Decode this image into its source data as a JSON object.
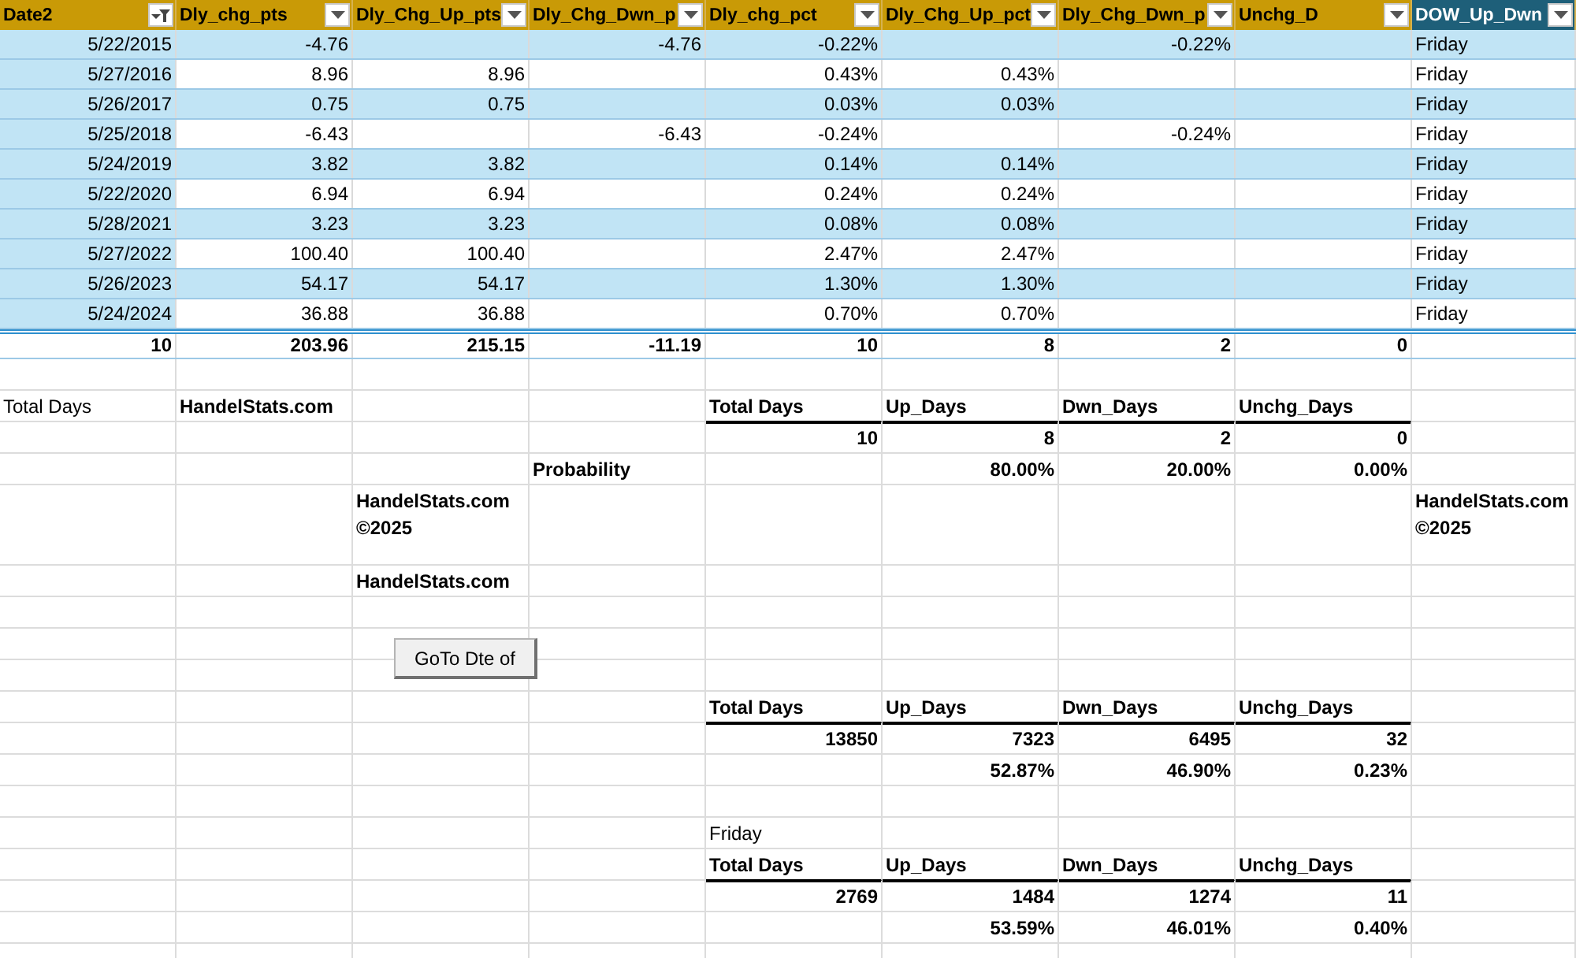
{
  "table": {
    "columns": [
      {
        "label": "Date2",
        "kind": "sorted",
        "selected": false
      },
      {
        "label": "Dly_chg_pts",
        "kind": "dropdown",
        "selected": false
      },
      {
        "label": "Dly_Chg_Up_pts",
        "kind": "dropdown",
        "selected": false
      },
      {
        "label": "Dly_Chg_Dwn_p",
        "kind": "dropdown",
        "selected": false
      },
      {
        "label": "Dly_chg_pct",
        "kind": "dropdown",
        "selected": false
      },
      {
        "label": "Dly_Chg_Up_pct",
        "kind": "dropdown",
        "selected": false
      },
      {
        "label": "Dly_Chg_Dwn_p",
        "kind": "dropdown",
        "selected": false
      },
      {
        "label": "Unchg_D",
        "kind": "dropdown",
        "selected": false
      },
      {
        "label": "DOW_Up_Dwn",
        "kind": "dropdown",
        "selected": true
      }
    ],
    "rows": [
      [
        "5/22/2015",
        "-4.76",
        null,
        "-4.76",
        "-0.22%",
        null,
        "-0.22%",
        null,
        "Friday"
      ],
      [
        "5/27/2016",
        "8.96",
        "8.96",
        null,
        "0.43%",
        "0.43%",
        null,
        null,
        "Friday"
      ],
      [
        "5/26/2017",
        "0.75",
        "0.75",
        null,
        "0.03%",
        "0.03%",
        null,
        null,
        "Friday"
      ],
      [
        "5/25/2018",
        "-6.43",
        null,
        "-6.43",
        "-0.24%",
        null,
        "-0.24%",
        null,
        "Friday"
      ],
      [
        "5/24/2019",
        "3.82",
        "3.82",
        null,
        "0.14%",
        "0.14%",
        null,
        null,
        "Friday"
      ],
      [
        "5/22/2020",
        "6.94",
        "6.94",
        null,
        "0.24%",
        "0.24%",
        null,
        null,
        "Friday"
      ],
      [
        "5/28/2021",
        "3.23",
        "3.23",
        null,
        "0.08%",
        "0.08%",
        null,
        null,
        "Friday"
      ],
      [
        "5/27/2022",
        "100.40",
        "100.40",
        null,
        "2.47%",
        "2.47%",
        null,
        null,
        "Friday"
      ],
      [
        "5/26/2023",
        "54.17",
        "54.17",
        null,
        "1.30%",
        "1.30%",
        null,
        null,
        "Friday"
      ],
      [
        "5/24/2024",
        "36.88",
        "36.88",
        null,
        "0.70%",
        "0.70%",
        null,
        null,
        "Friday"
      ]
    ],
    "totals": [
      "10",
      "203.96",
      "215.15",
      "-11.19",
      "10",
      "8",
      "2",
      "0"
    ]
  },
  "sheet_rows": [
    {
      "kind": "blank"
    },
    {
      "kind": "normal",
      "cells": [
        {
          "text": "Total Days",
          "kind": "label"
        },
        {
          "text": "HandelStats.com",
          "kind": "bold"
        },
        null,
        null,
        {
          "text": "Total Days",
          "kind": "heading"
        },
        {
          "text": "Up_Days",
          "kind": "heading"
        },
        {
          "text": "Dwn_Days",
          "kind": "heading"
        },
        {
          "text": "Unchg_Days",
          "kind": "heading"
        },
        null
      ]
    },
    {
      "kind": "normal",
      "cells": [
        null,
        null,
        null,
        null,
        {
          "text": "10",
          "kind": "figure"
        },
        {
          "text": "8",
          "kind": "figure"
        },
        {
          "text": "2",
          "kind": "figure"
        },
        {
          "text": "0",
          "kind": "figure"
        },
        null
      ]
    },
    {
      "kind": "normal",
      "cells": [
        null,
        null,
        null,
        {
          "text": "Probability",
          "kind": "bold"
        },
        null,
        {
          "text": "80.00%",
          "kind": "figure"
        },
        {
          "text": "20.00%",
          "kind": "figure"
        },
        {
          "text": "0.00%",
          "kind": "figure"
        },
        null
      ]
    },
    {
      "kind": "tall",
      "cells": [
        null,
        null,
        {
          "text": "HandelStats.com ©2025",
          "kind": "bold"
        },
        null,
        null,
        null,
        null,
        null,
        {
          "text": "HandelStats.com ©2025",
          "kind": "bold"
        }
      ]
    },
    {
      "kind": "normal",
      "cells": [
        null,
        null,
        {
          "text": "HandelStats.com",
          "kind": "bold"
        },
        null,
        null,
        null,
        null,
        null,
        null
      ]
    },
    {
      "kind": "blank"
    },
    {
      "kind": "blank"
    },
    {
      "kind": "blank"
    },
    {
      "kind": "normal",
      "cells": [
        null,
        null,
        null,
        null,
        {
          "text": "Total Days",
          "kind": "heading"
        },
        {
          "text": "Up_Days",
          "kind": "heading"
        },
        {
          "text": "Dwn_Days",
          "kind": "heading"
        },
        {
          "text": "Unchg_Days",
          "kind": "heading"
        },
        null
      ]
    },
    {
      "kind": "normal",
      "cells": [
        null,
        null,
        null,
        null,
        {
          "text": "13850",
          "kind": "figure"
        },
        {
          "text": "7323",
          "kind": "figure"
        },
        {
          "text": "6495",
          "kind": "figure"
        },
        {
          "text": "32",
          "kind": "figure"
        },
        null
      ]
    },
    {
      "kind": "normal",
      "cells": [
        null,
        null,
        null,
        null,
        null,
        {
          "text": "52.87%",
          "kind": "figure"
        },
        {
          "text": "46.90%",
          "kind": "figure"
        },
        {
          "text": "0.23%",
          "kind": "figure"
        },
        null
      ]
    },
    {
      "kind": "blank"
    },
    {
      "kind": "normal",
      "cells": [
        null,
        null,
        null,
        null,
        {
          "text": "Friday",
          "kind": "label"
        },
        null,
        null,
        null,
        null
      ]
    },
    {
      "kind": "normal",
      "cells": [
        null,
        null,
        null,
        null,
        {
          "text": "Total Days",
          "kind": "heading"
        },
        {
          "text": "Up_Days",
          "kind": "heading"
        },
        {
          "text": "Dwn_Days",
          "kind": "heading"
        },
        {
          "text": "Unchg_Days",
          "kind": "heading"
        },
        null
      ]
    },
    {
      "kind": "normal",
      "cells": [
        null,
        null,
        null,
        null,
        {
          "text": "2769",
          "kind": "figure"
        },
        {
          "text": "1484",
          "kind": "figure"
        },
        {
          "text": "1274",
          "kind": "figure"
        },
        {
          "text": "11",
          "kind": "figure"
        },
        null
      ]
    },
    {
      "kind": "normal",
      "cells": [
        null,
        null,
        null,
        null,
        null,
        {
          "text": "53.59%",
          "kind": "figure"
        },
        {
          "text": "46.01%",
          "kind": "figure"
        },
        {
          "text": "0.40%",
          "kind": "figure"
        },
        null
      ]
    },
    {
      "kind": "blank"
    }
  ],
  "goto_button": {
    "label": "GoTo Dte of"
  }
}
